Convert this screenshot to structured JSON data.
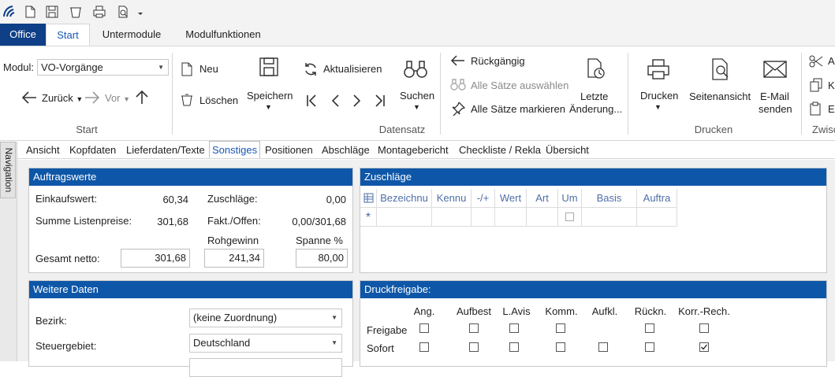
{
  "tabs": {
    "office": "Office",
    "start": "Start",
    "untermodule": "Untermodule",
    "modulfunktionen": "Modulfunktionen"
  },
  "ribbon": {
    "modul_label": "Modul:",
    "modul_value": "VO-Vorgänge",
    "zurueck": "Zurück",
    "vor": "Vor",
    "neu": "Neu",
    "loeschen": "Löschen",
    "speichern": "Speichern",
    "aktualisieren": "Aktualisieren",
    "suchen": "Suchen",
    "rueckgaengig": "Rückgängig",
    "alle_saetze_auswaehlen": "Alle Sätze auswählen",
    "alle_saetze_markieren": "Alle Sätze markieren",
    "letzte_1": "Letzte",
    "letzte_2": "Änderung...",
    "drucken": "Drucken",
    "seitenansicht": "Seitenansicht",
    "email_1": "E-Mail",
    "email_2": "senden",
    "cut_right": "A",
    "copy_right": "K",
    "paste_right": "E",
    "groups": {
      "start": "Start",
      "datensatz": "Datensatz",
      "drucken": "Drucken",
      "zwisch": "Zwisc"
    }
  },
  "navigation_label": "Navigation",
  "subtabs": [
    "Ansicht",
    "Kopfdaten",
    "Lieferdaten/Texte",
    "Sonstiges",
    "Positionen",
    "Abschläge",
    "Montagebericht",
    "Checkliste / Rekla",
    "Übersicht"
  ],
  "auftragswerte": {
    "title": "Auftragswerte",
    "einkaufswert_label": "Einkaufswert:",
    "einkaufswert": "60,34",
    "summe_label": "Summe Listenpreise:",
    "summe": "301,68",
    "zuschlaege_label": "Zuschläge:",
    "zuschlaege": "0,00",
    "fakt_label": "Fakt./Offen:",
    "fakt": "0,00/301,68",
    "rohgewinn_label": "Rohgewinn",
    "spanne_label": "Spanne %",
    "gesamt_label": "Gesamt netto:",
    "gesamt": "301,68",
    "rohgewinn": "241,34",
    "spanne": "80,00"
  },
  "zuschlaege_panel": {
    "title": "Zuschläge",
    "columns": [
      "Bezeichnu",
      "Kennu",
      "-/+",
      "Wert",
      "Art",
      "Um",
      "Basis",
      "Auftra"
    ],
    "new_row_marker": "*"
  },
  "weitere": {
    "title": "Weitere Daten",
    "bezirk_label": "Bezirk:",
    "bezirk_value": "(keine Zuordnung)",
    "steuer_label": "Steuergebiet:",
    "steuer_value": "Deutschland"
  },
  "druckfreigabe": {
    "title": "Druckfreigabe:",
    "columns": [
      "Ang.",
      "Aufbest",
      "L.Avis",
      "Komm.",
      "Aufkl.",
      "Rückn.",
      "Korr.-Rech."
    ],
    "rows": [
      {
        "label": "Freigabe",
        "checks": [
          false,
          false,
          false,
          false,
          null,
          false,
          false
        ]
      },
      {
        "label": "Sofort",
        "checks": [
          false,
          false,
          false,
          false,
          false,
          false,
          true
        ]
      }
    ]
  }
}
